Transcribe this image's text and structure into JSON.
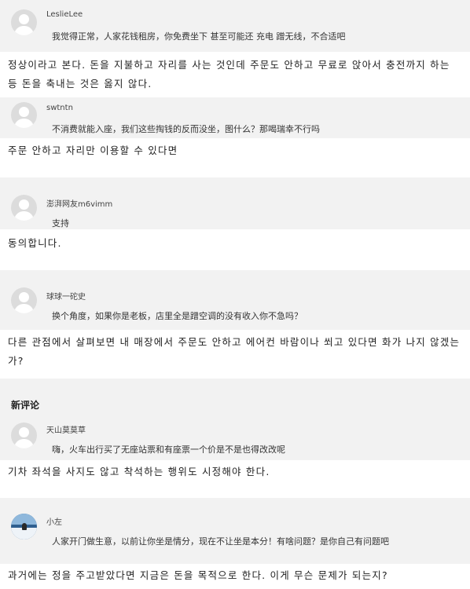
{
  "comments": [
    {
      "username": "LeslieLee",
      "text": "我觉得正常，人家花钱租房，你免费坐下 甚至可能还 充电 蹭无线，不合适吧",
      "translation": "정상이라고 본다. 돈을 지불하고 자리를 사는 것인데 주문도 안하고 무료로 앉아서 충전까지 하는 등 돈을 축내는 것은 옳지 않다."
    },
    {
      "username": "swtntn",
      "text": "不消费就能入座，我们这些掏钱的反而没坐，图什么？那喝瑞幸不行吗",
      "translation": "주문 안하고 자리만 이용할 수 있다면"
    },
    {
      "username": "澎湃网友m6vimm",
      "text": "支持",
      "translation": "동의합니다."
    },
    {
      "username": "球球一砣史",
      "text": "换个角度，如果你是老板，店里全是蹭空调的没有收入你不急吗？",
      "translation": "다른 관점에서 살펴보면 내 매장에서 주문도 안하고 에어컨 바람이나 쐬고 있다면 화가 나지 않겠는가?"
    }
  ],
  "new_comments_title": "新评论",
  "new_comments": [
    {
      "username": "天山莫莫草",
      "text": "嗨，火车出行买了无座站票和有座票一个价是不是也得改改呢",
      "translation": "기차 좌석을 사지도 않고 착석하는 행위도 시정해야 한다."
    },
    {
      "username": "小左",
      "text": "人家开门做生意，以前让你坐是情分，现在不让坐是本分！有啥问题？是你自己有问题吧",
      "translation": "과거에는 정을 주고받았다면 지금은 돈을 목적으로 한다. 이게 무슨 문제가 되는지?"
    }
  ]
}
